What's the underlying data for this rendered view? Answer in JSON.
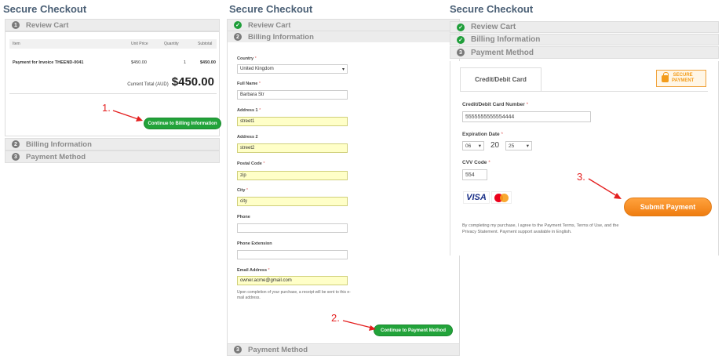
{
  "panel1": {
    "title": "Secure Checkout",
    "step1": {
      "num": "1",
      "label": "Review Cart"
    },
    "cart": {
      "headers": [
        "Item",
        "Unit Price",
        "Quantity",
        "Subtotal"
      ],
      "row": {
        "item": "Payment for Invoice THEEND-0041",
        "unit_price": "$450.00",
        "quantity": "1",
        "subtotal": "$450.00"
      },
      "total_label": "Current Total (AUD)",
      "total_value": "$450.00"
    },
    "button": "Continue to Billing Information",
    "step2": {
      "num": "2",
      "label": "Billing Information"
    },
    "step3": {
      "num": "3",
      "label": "Payment Method"
    },
    "annotation": "1."
  },
  "panel2": {
    "title": "Secure Checkout",
    "step1": {
      "label": "Review Cart"
    },
    "step2": {
      "num": "2",
      "label": "Billing Information"
    },
    "fields": {
      "country": {
        "label": "Country",
        "value": "United Kingdom"
      },
      "full_name": {
        "label": "Full Name",
        "value": "Barbara Str"
      },
      "address1": {
        "label": "Address 1",
        "value": "street1"
      },
      "address2": {
        "label": "Address 2",
        "value": "street2"
      },
      "postal": {
        "label": "Postal Code",
        "value": "zip"
      },
      "city": {
        "label": "City",
        "value": "city"
      },
      "phone": {
        "label": "Phone",
        "value": ""
      },
      "phone_ext": {
        "label": "Phone Extension",
        "value": ""
      },
      "email": {
        "label": "Email Address",
        "value": "owner.acme@gmail.com"
      }
    },
    "req": "*",
    "note": "Upon completion of your purchase, a receipt will be sent to this e-mail address.",
    "button": "Continue to Payment Method",
    "step3": {
      "num": "3",
      "label": "Payment Method"
    },
    "annotation": "2."
  },
  "panel3": {
    "title": "Secure Checkout",
    "step1": {
      "label": "Review Cart"
    },
    "step2": {
      "label": "Billing Information"
    },
    "step3": {
      "num": "3",
      "label": "Payment Method"
    },
    "tab": "Credit/Debit Card",
    "secure_line1": "SECURE",
    "secure_line2": "PAYMENT",
    "card_number_label": "Credit/Debit Card Number",
    "card_number": "5555555555554444",
    "expiry_label": "Expiration Date",
    "expiry_month": "06",
    "expiry_prefix": "20",
    "expiry_year": "25",
    "cvv_label": "CVV Code",
    "cvv": "554",
    "visa": "VISA",
    "mastercard_text": "MasterCard",
    "submit": "Submit Payment",
    "agree_text": "By completing my purchase, I agree to the Payment Terms, Terms of Use, and the Privacy Statement. Payment support available in English.",
    "annotation": "3."
  },
  "check": "✓",
  "colors": {
    "accent_green": "#22a33a",
    "annotation_red": "#e41f1f",
    "submit_orange": "#f38c1e",
    "autofill_yellow": "#ffffc8"
  }
}
